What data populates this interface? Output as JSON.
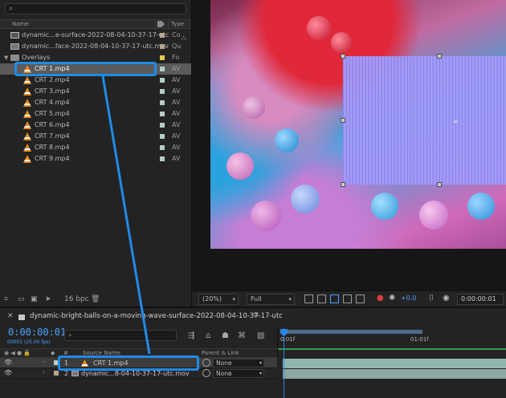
{
  "project": {
    "search_icon": "search-icon",
    "columns": {
      "name": "Name",
      "type": "Type"
    },
    "items": [
      {
        "name": "dynamic...e-surface-2022-08-04-10-37-17-utc",
        "kind": "comp",
        "type": "Co",
        "swatch": "#b8a890"
      },
      {
        "name": "dynamic...face-2022-08-04-10-37-17-utc.mov",
        "kind": "footage",
        "type": "Qu",
        "swatch": "#b8a890"
      },
      {
        "name": "Overlays",
        "kind": "folder",
        "type": "Fo",
        "swatch": "#e6c84a"
      },
      {
        "name": "CRT 1.mp4",
        "kind": "vlc",
        "type": "AV",
        "swatch": "#b8ccc6",
        "selected": true
      },
      {
        "name": "CRT 2.mp4",
        "kind": "vlc",
        "type": "AV",
        "swatch": "#b8ccc6"
      },
      {
        "name": "CRT 3.mp4",
        "kind": "vlc",
        "type": "AV",
        "swatch": "#b8ccc6"
      },
      {
        "name": "CRT 4.mp4",
        "kind": "vlc",
        "type": "AV",
        "swatch": "#b8ccc6"
      },
      {
        "name": "CRT 5.mp4",
        "kind": "vlc",
        "type": "AV",
        "swatch": "#b8ccc6"
      },
      {
        "name": "CRT 6.mp4",
        "kind": "vlc",
        "type": "AV",
        "swatch": "#b8ccc6"
      },
      {
        "name": "CRT 7.mp4",
        "kind": "vlc",
        "type": "AV",
        "swatch": "#b8ccc6"
      },
      {
        "name": "CRT 8.mp4",
        "kind": "vlc",
        "type": "AV",
        "swatch": "#b8ccc6"
      },
      {
        "name": "CRT 9.mp4",
        "kind": "vlc",
        "type": "AV",
        "swatch": "#b8ccc6"
      }
    ],
    "bpc": "16 bpc"
  },
  "viewer": {
    "zoom": "(20%)",
    "resolution": "Full",
    "exposure": "+0.0",
    "timecode": "0:00:00:01"
  },
  "timeline": {
    "comp_title": "dynamic-bright-balls-on-a-moving-wave-surface-2022-08-04-10-37-17-utc",
    "current_time": "0:00:00:01",
    "frames_info": "00001 (25.00 fps)",
    "columns": {
      "source_name": "Source Name",
      "parent_link": "Parent & Link"
    },
    "ruler_labels": [
      "0:01f",
      "01:01f"
    ],
    "layers": [
      {
        "num": "1",
        "name": "CRT 1.mp4",
        "parent": "None",
        "label_color": "#b8ccc6"
      },
      {
        "num": "2",
        "name": "dynamic...8-04-10-37-17-utc.mov",
        "parent": "None",
        "label_color": "#b8a890"
      }
    ]
  },
  "colors": {
    "accent": "#1f8be6",
    "timecode": "#4aa3ff"
  }
}
